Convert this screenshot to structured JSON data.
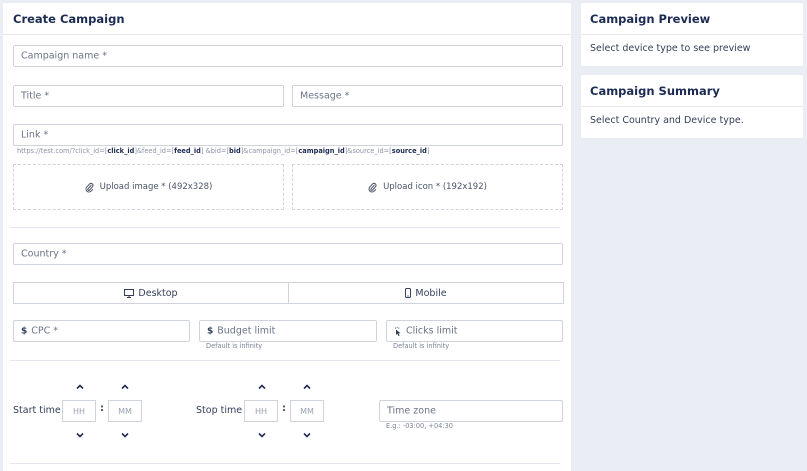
{
  "create": {
    "title": "Create Campaign",
    "campaign_name": "Campaign name *",
    "title_field": "Title *",
    "message_field": "Message *",
    "link_field": "Link *",
    "link_hint": {
      "p1": "https://test.com/?click_id=[",
      "click_id": "click_id",
      "p2": "]&feed_id=[",
      "feed_id": "feed_id",
      "p3": "] &bid=[",
      "bid": "bid",
      "p4": "]&campaign_id=[",
      "campaign_id": "campaign_id",
      "p5": "]&source_id=[",
      "source_id": "source_id",
      "p6": "]"
    },
    "upload_image": "Upload image * (492x328)",
    "upload_icon": "Upload icon * (192x192)",
    "country_field": "Country *",
    "device_desktop": "Desktop",
    "device_mobile": "Mobile",
    "cpc_field": "CPC *",
    "budget_field": "Budget limit",
    "budget_hint": "Default is infinity",
    "clicks_field": "Clicks limit",
    "clicks_hint": "Default is infinity",
    "start_time_label": "Start time",
    "stop_time_label": "Stop time",
    "hh": "HH",
    "mm": "MM",
    "colon": ":",
    "timezone_field": "Time zone",
    "timezone_hint": "E.g.: -03:00, +04:30"
  },
  "preview": {
    "title": "Campaign Preview",
    "text": "Select device type to see preview"
  },
  "summary": {
    "title": "Campaign Summary",
    "text": "Select Country and Device type."
  },
  "icons": {
    "upload": "paperclip-icon",
    "desktop": "monitor-icon",
    "mobile": "phone-icon",
    "currency": "dollar-icon",
    "clicks": "pointer-icon",
    "increment": "chevron-up-icon",
    "decrement": "chevron-down-icon"
  }
}
